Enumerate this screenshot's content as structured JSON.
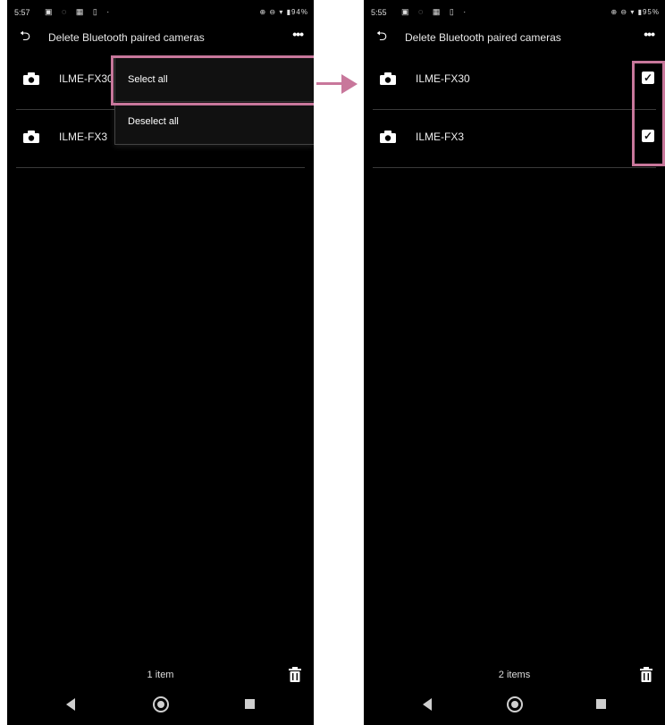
{
  "left_screen": {
    "status": {
      "time": "5:57",
      "left_icons": "▣ ◌ ▦ ▯ ·",
      "right_icons": "⊕ ⊖ ▾ ▮94%"
    },
    "appbar": {
      "title": "Delete Bluetooth paired cameras"
    },
    "rows": [
      {
        "name": "ILME-FX30"
      },
      {
        "name": "ILME-FX3"
      }
    ],
    "menu": {
      "select_all": "Select all",
      "deselect_all": "Deselect all"
    },
    "footer": {
      "count": "1 item"
    }
  },
  "right_screen": {
    "status": {
      "time": "5:55",
      "left_icons": "▣ ◌ ▦ ▯ ·",
      "right_icons": "⊕ ⊖ ▾ ▮95%"
    },
    "appbar": {
      "title": "Delete Bluetooth paired cameras"
    },
    "rows": [
      {
        "name": "ILME-FX30",
        "checked": true
      },
      {
        "name": "ILME-FX3",
        "checked": true
      }
    ],
    "footer": {
      "count": "2 items"
    }
  },
  "colors": {
    "highlight": "#c8779b",
    "screen_bg": "#000000"
  }
}
